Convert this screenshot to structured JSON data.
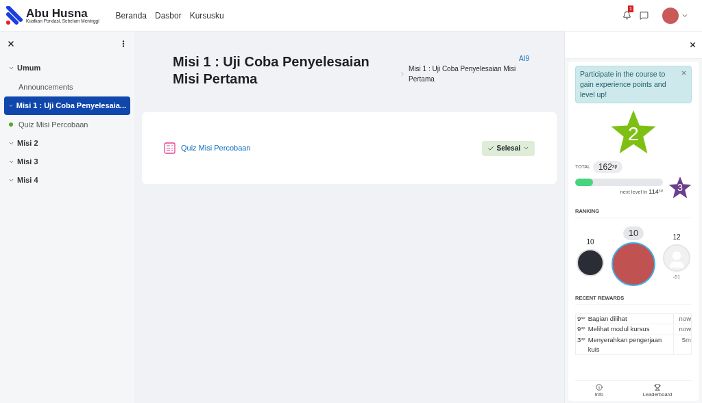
{
  "header": {
    "brand": "Abu Husna",
    "tagline": "Kuatkan Pondasi, Sebelum Meninggi",
    "nav": [
      "Beranda",
      "Dasbor",
      "Kursusku"
    ],
    "notification_count": "1"
  },
  "sidebar": {
    "items": [
      {
        "kind": "section",
        "label": "Umum",
        "selected": false
      },
      {
        "kind": "activity",
        "label": "Announcements",
        "selected": false,
        "completed": false
      },
      {
        "kind": "section",
        "label": "Misi 1 : Uji Coba Penyelesaia...",
        "selected": true
      },
      {
        "kind": "activity",
        "label": "Quiz Misi Percobaan",
        "selected": false,
        "completed": true
      },
      {
        "kind": "section",
        "label": "Misi 2",
        "selected": false
      },
      {
        "kind": "section",
        "label": "Misi 3",
        "selected": false
      },
      {
        "kind": "section",
        "label": "Misi 4",
        "selected": false
      }
    ]
  },
  "page": {
    "title": "Misi 1 : Uji Coba Penyelesaian Misi Pertama",
    "breadcrumb": [
      "AI9",
      "Misi 1 : Uji Coba Penyelesaian Misi Pertama"
    ],
    "activity": {
      "name": "Quiz Misi Percobaan",
      "status": "Selesai"
    }
  },
  "drawer": {
    "notice": "Participate in the course to gain experience points and level up!",
    "current_level": "2",
    "total_label": "TOTAL",
    "total": "162",
    "total_unit": "xp",
    "progress": {
      "level": 0.2
    },
    "next_level_text": "next level in",
    "next_level_xp": "114",
    "next_level_unit": "xp",
    "next_level": "3",
    "ranking_label": "RANKING",
    "ranking": [
      {
        "rank": "10",
        "selected": false,
        "kind": "photo"
      },
      {
        "rank": "10",
        "selected": true,
        "kind": "photo"
      },
      {
        "rank": "12",
        "selected": false,
        "kind": "silhouette",
        "diff": "-51"
      }
    ],
    "rewards_label": "RECENT REWARDS",
    "rewards": [
      {
        "xp": "9",
        "unit": "xp",
        "description": "Bagian dilihat",
        "time": "now"
      },
      {
        "xp": "9",
        "unit": "xp",
        "description": "Melihat modul kursus",
        "time": "now"
      },
      {
        "xp": "3",
        "unit": "xp",
        "description": "Menyerahkan pengerjaan kuis",
        "time": "5m"
      }
    ],
    "footer": [
      "Info",
      "Leaderboard"
    ]
  }
}
